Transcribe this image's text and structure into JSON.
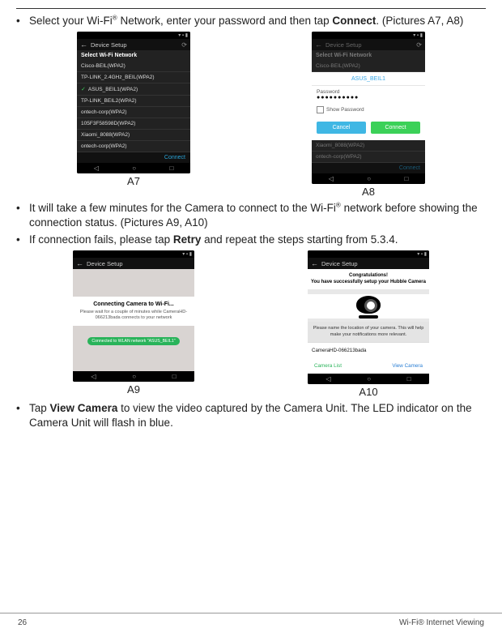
{
  "instructions": {
    "step1_a": "Select your Wi-Fi",
    "step1_b": " Network, enter your password and then tap ",
    "step1_bold": "Connect",
    "step1_c": ". (Pictures A7, A8)",
    "step2_a": "It will take a few minutes for the Camera to connect to the Wi-Fi",
    "step2_b": " network before showing the connection status. (Pictures A9, A10)",
    "step3_a": "If connection fails, please tap ",
    "step3_bold": "Retry",
    "step3_b": " and repeat the steps starting from 5.3.4.",
    "step4_a": "Tap ",
    "step4_bold": "View Camera",
    "step4_b": " to view the video captured by the Camera Unit. The LED indicator on the Camera Unit will flash in blue."
  },
  "reg": "®",
  "captions": {
    "a7": "A7",
    "a8": "A8",
    "a9": "A9",
    "a10": "A10"
  },
  "phoneA7": {
    "title": "Device Setup",
    "panel": "Select Wi-Fi Network",
    "networks": [
      "Cisco-BEIL(WPA2)",
      "TP-LINK_2.4GHz_BEIL(WPA2)",
      "ASUS_BEIL1(WPA2)",
      "TP-LINK_BEIL2(WPA2)",
      "ontech-corp(WPA2)",
      "105F3F58598D(WPA2)",
      "Xiaomi_8088(WPA2)",
      "ontech-corp(WPA2)"
    ],
    "connect": "Connect"
  },
  "phoneA8": {
    "title": "Device Setup",
    "panel": "Select Wi-Fi Network",
    "dimNet": "Cisco-BEIL(WPA2)",
    "dlgTitle": "ASUS_BEIL1",
    "pwdLabel": "Password",
    "pwdVal": "●●●●●●●●●●",
    "show": "Show Password",
    "cancel": "Cancel",
    "connect": "Connect",
    "dimNet2": "Xiaomi_8088(WPA2)",
    "dimNet3": "ontech-corp(WPA2)",
    "foot": "Connect"
  },
  "phoneA9": {
    "title": "Device Setup",
    "h": "Connecting Camera to Wi-Fi...",
    "p": "Please wait for a couple of minutes while CameraHD-066213bada connects to your network",
    "badge": "Connected to WLAN network \"ASUS_BEIL1\""
  },
  "phoneA10": {
    "title": "Device Setup",
    "congrats1": "Congratulations!",
    "congrats2": "You have successfully setup your Hubble Camera",
    "mid": "Please name the location of your camera. This will help make your notifications more relevant.",
    "name": "CameraHD-066213bada",
    "camlist": "Camera List",
    "viewcam": "View Camera"
  },
  "footer": {
    "page": "26",
    "section": "Wi-Fi® Internet Viewing"
  }
}
